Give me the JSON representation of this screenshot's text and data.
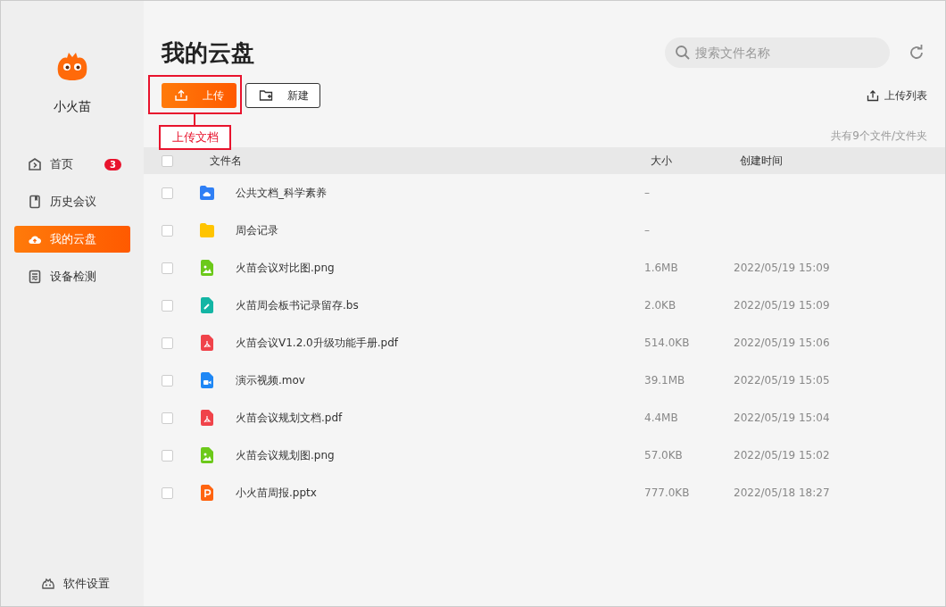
{
  "sidebar": {
    "app_name": "小火苗",
    "items": [
      {
        "label": "首页",
        "kind": "home",
        "badge": "3",
        "selected": false
      },
      {
        "label": "历史会议",
        "kind": "book",
        "selected": false
      },
      {
        "label": "我的云盘",
        "kind": "cloud",
        "selected": true
      },
      {
        "label": "设备检测",
        "kind": "device",
        "selected": false
      }
    ],
    "footer": {
      "label": "软件设置"
    }
  },
  "header": {
    "title": "我的云盘",
    "search": {
      "placeholder": "搜索文件名称"
    }
  },
  "toolbar": {
    "buttons": [
      {
        "label": "上传",
        "kind": "primary"
      },
      {
        "label": "新建",
        "kind": "outline"
      }
    ],
    "upload_list": "上传列表"
  },
  "count": "共有9个文件/文件夹",
  "callout": {
    "label": "上传文档"
  },
  "table": {
    "all_checked": false,
    "columns": [
      "文件名",
      "大小",
      "创建时间"
    ],
    "rows": [
      {
        "name": "公共文档_科学素养",
        "kind": "cloud-folder",
        "size": "–",
        "created": "",
        "checked": false
      },
      {
        "name": "周会记录",
        "kind": "folder",
        "size": "–",
        "created": "",
        "checked": false
      },
      {
        "name": "火苗会议对比图.png",
        "kind": "image",
        "size": "1.6MB",
        "created": "2022/05/19 15:09",
        "checked": false
      },
      {
        "name": "火苗周会板书记录留存.bs",
        "kind": "note",
        "size": "2.0KB",
        "created": "2022/05/19 15:09",
        "checked": false
      },
      {
        "name": "火苗会议V1.2.0升级功能手册.pdf",
        "kind": "pdf",
        "size": "514.0KB",
        "created": "2022/05/19 15:06",
        "checked": false
      },
      {
        "name": "演示视频.mov",
        "kind": "video",
        "size": "39.1MB",
        "created": "2022/05/19 15:05",
        "checked": false
      },
      {
        "name": "火苗会议规划文档.pdf",
        "kind": "pdf",
        "size": "4.4MB",
        "created": "2022/05/19 15:04",
        "checked": false
      },
      {
        "name": "火苗会议规划图.png",
        "kind": "image",
        "size": "57.0KB",
        "created": "2022/05/19 15:02",
        "checked": false
      },
      {
        "name": "小火苗周报.pptx",
        "kind": "pptx",
        "size": "777.0KB",
        "created": "2022/05/18 18:27",
        "checked": false
      }
    ]
  }
}
